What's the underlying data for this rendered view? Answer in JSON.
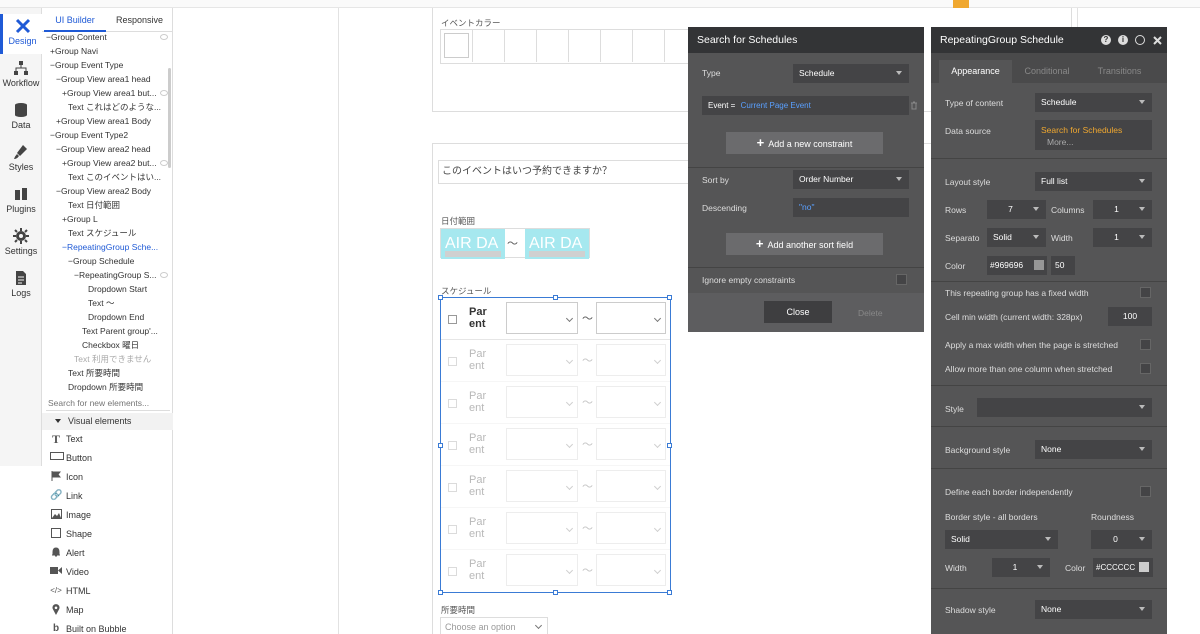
{
  "sidebar": {
    "items": [
      {
        "label": "Design",
        "icon": "design-icon",
        "active": true
      },
      {
        "label": "Workflow",
        "icon": "workflow-icon"
      },
      {
        "label": "Data",
        "icon": "data-icon"
      },
      {
        "label": "Styles",
        "icon": "styles-icon"
      },
      {
        "label": "Plugins",
        "icon": "plugins-icon"
      },
      {
        "label": "Settings",
        "icon": "settings-icon"
      },
      {
        "label": "Logs",
        "icon": "logs-icon"
      }
    ],
    "accent_color": "#1f5ad6"
  },
  "tree": {
    "tabs": [
      "UI Builder",
      "Responsive"
    ],
    "rows": [
      "−Group Content",
      "+Group Navi",
      "−Group Event Type",
      "−Group View area1 head",
      "+Group View area1 but...",
      "Text これはどのような...",
      "+Group View area1 Body",
      "−Group Event Type2",
      "−Group View area2 head",
      "+Group View area2 but...",
      "Text このイベントはい...",
      "−Group View area2 Body",
      "Text 日付範囲",
      "+Group L",
      "Text スケジュール",
      "−RepeatingGroup Sche...",
      "−Group Schedule",
      "−RepeatingGroup S...",
      "Dropdown Start",
      "Text ～",
      "Dropdown End",
      "Text Parent group'...",
      "Checkbox 曜日",
      "Text 利用できません",
      "Text 所要時間",
      "Dropdown 所要時間"
    ]
  },
  "visual": {
    "search_placeholder": "Search for new elements...",
    "header": "Visual elements",
    "items": [
      {
        "label": "Text",
        "icon": "text-icon"
      },
      {
        "label": "Button",
        "icon": "button-icon"
      },
      {
        "label": "Icon",
        "icon": "flag-icon"
      },
      {
        "label": "Link",
        "icon": "link-icon"
      },
      {
        "label": "Image",
        "icon": "image-icon"
      },
      {
        "label": "Shape",
        "icon": "shape-icon"
      },
      {
        "label": "Alert",
        "icon": "bell-icon"
      },
      {
        "label": "Video",
        "icon": "video-icon"
      },
      {
        "label": "HTML",
        "icon": "code-icon"
      },
      {
        "label": "Map",
        "icon": "map-pin-icon"
      },
      {
        "label": "Built on Bubble",
        "icon": "bubble-icon"
      }
    ]
  },
  "canvas": {
    "event_color_label": "イベントカラー",
    "question_text": "このイベントはいつ予約できますか？",
    "date_range_label": "日付範囲",
    "air_date_text": "AIR DA",
    "tilde": "～",
    "schedule_label": "スケジュール",
    "parent_text": "Par ent",
    "duration_label": "所要時間",
    "duration_placeholder": "Choose an option"
  },
  "search_panel": {
    "title": "Search for Schedules",
    "type_label": "Type",
    "type_value": "Schedule",
    "constraint_key": "Event =",
    "constraint_value": "Current Page Event",
    "add_constraint": "Add a new constraint",
    "sort_by_label": "Sort by",
    "sort_by_value": "Order Number",
    "descending_label": "Descending",
    "descending_value": "\"no\"",
    "add_sort": "Add another sort field",
    "ignore_empty": "Ignore empty constraints",
    "close": "Close",
    "delete": "Delete"
  },
  "props_panel": {
    "title": "RepeatingGroup Schedule",
    "tabs": [
      "Appearance",
      "Conditional",
      "Transitions"
    ],
    "type_of_content_label": "Type of content",
    "type_of_content_value": "Schedule",
    "data_source_label": "Data source",
    "data_source_value": "Search for Schedules",
    "data_source_more": "More...",
    "layout_style_label": "Layout style",
    "layout_style_value": "Full list",
    "rows_label": "Rows",
    "rows_value": "7",
    "columns_label": "Columns",
    "columns_value": "1",
    "separator_label": "Separato",
    "separator_value": "Solid",
    "width_label": "Width",
    "width_value": "1",
    "color_label": "Color",
    "color_value": "#969696",
    "opacity_value": "50",
    "fixed_width": "This repeating group has a fixed width",
    "cell_min_width_label": "Cell min width (current width: 328px)",
    "cell_min_width_value": "100",
    "apply_max_width": "Apply a max width when the page is stretched",
    "allow_more_columns": "Allow more than one column when stretched",
    "style_label": "Style",
    "background_style_label": "Background style",
    "background_style_value": "None",
    "define_border": "Define each border independently",
    "border_style_label": "Border style - all borders",
    "roundness_label": "Roundness",
    "border_style_value": "Solid",
    "roundness_value": "0",
    "border_width_label": "Width",
    "border_width_value": "1",
    "border_color_label": "Color",
    "border_color_value": "#CCCCCC",
    "shadow_style_label": "Shadow style",
    "shadow_style_value": "None",
    "highlight_color": "#f0a830",
    "link_color": "#5aa0ff"
  }
}
